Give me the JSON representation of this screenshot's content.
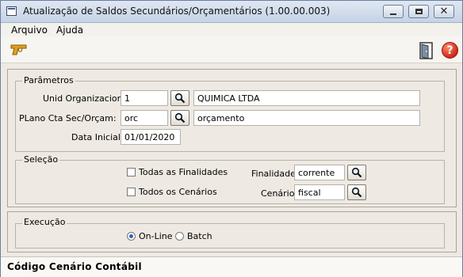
{
  "window": {
    "title": "Atualização de Saldos Secundários/Orçamentários (1.00.00.003)"
  },
  "menu": {
    "arquivo": "Arquivo",
    "ajuda": "Ajuda"
  },
  "parametros": {
    "title": "Parâmetros",
    "unid_org": {
      "label": "Unid Organizacional:",
      "value": "1",
      "description": "QUIMICA LTDA"
    },
    "plano": {
      "label": "PLano Cta Sec/Orçam:",
      "value": "orc",
      "description": "orçamento"
    },
    "data_inicial": {
      "label": "Data Inicial:",
      "value": "01/01/2020"
    }
  },
  "selecao": {
    "title": "Seleção",
    "todas_finalidades": "Todas as Finalidades",
    "todos_cenarios": "Todos os Cenários",
    "finalidade": {
      "label": "Finalidade:",
      "value": "corrente"
    },
    "cenario": {
      "label": "Cenário:",
      "value": "fiscal"
    }
  },
  "execucao": {
    "title": "Execução",
    "online": "On-Line",
    "batch": "Batch",
    "selected": "On-Line"
  },
  "status": "Código Cenário Contábil",
  "icons": {
    "pistol": "pistol-icon",
    "exit": "exit-door-icon",
    "help": "help-icon",
    "search": "search-icon"
  }
}
